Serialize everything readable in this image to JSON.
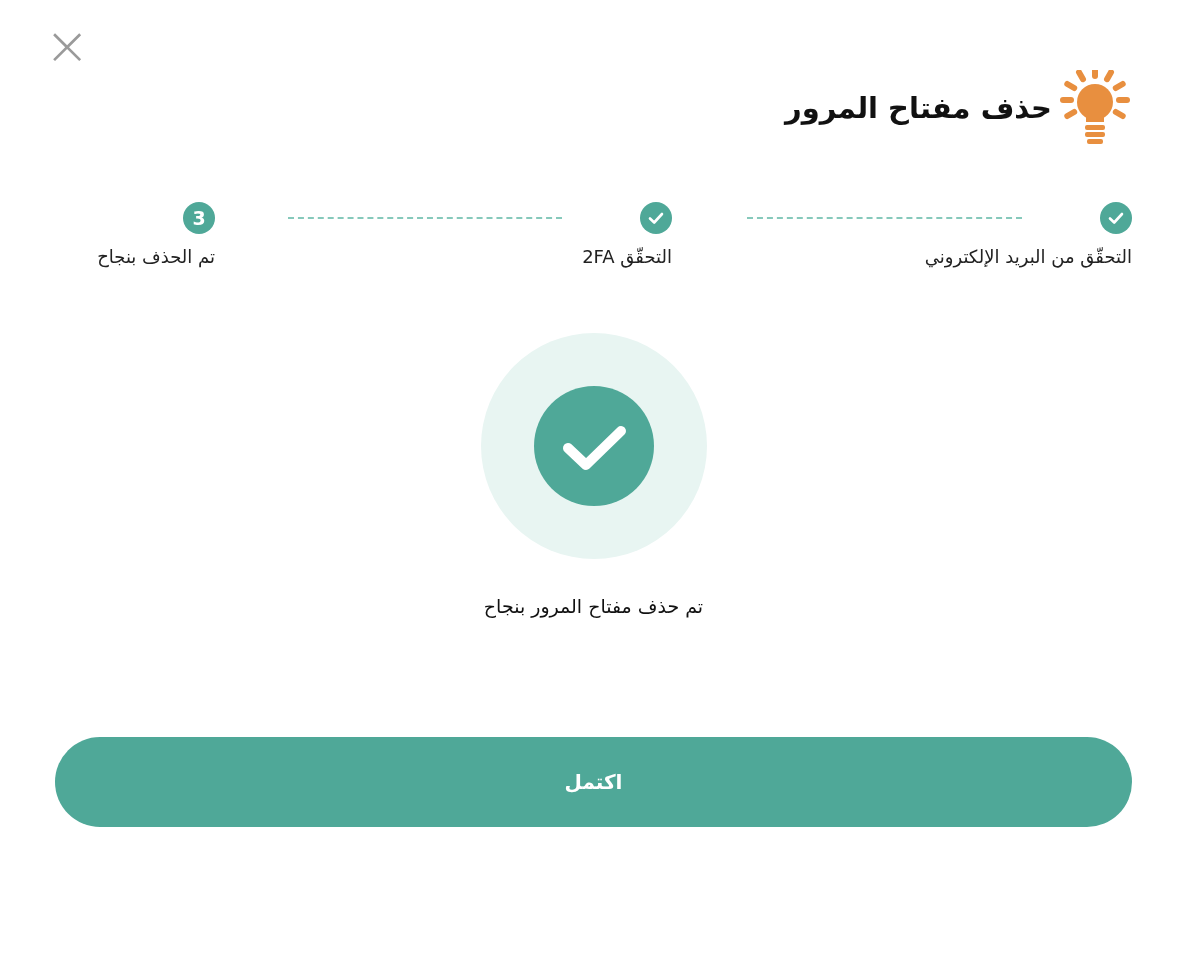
{
  "close_button": {
    "label": "×"
  },
  "title": "حذف مفتاح المرور",
  "steps": [
    {
      "label": "التحقّق من البريد الإلكتروني",
      "completed": true
    },
    {
      "label": "التحقّق 2FA",
      "completed": true
    },
    {
      "label": "تم الحذف بنجاح",
      "completed": false,
      "number": "3"
    }
  ],
  "result": {
    "message": "تم حذف مفتاح المرور بنجاح"
  },
  "button": {
    "label": "اكتمل"
  }
}
